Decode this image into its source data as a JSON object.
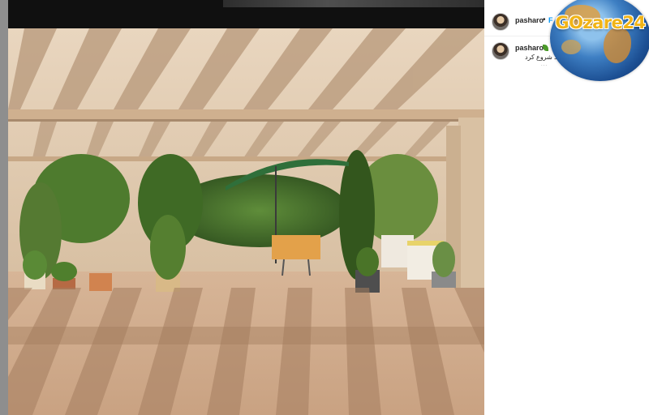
{
  "post": {
    "author": "pasharo",
    "separator": "•",
    "follow_label": "F"
  },
  "comment": {
    "author": "pasharo",
    "text": "... باید شروع کرد",
    "meta": "..."
  },
  "logo": {
    "text": "GOzare24"
  },
  "colors": {
    "follow_blue": "#0095f6",
    "logo_gold": "#f1b417",
    "sidebar_gray": "#8e8e8e"
  }
}
